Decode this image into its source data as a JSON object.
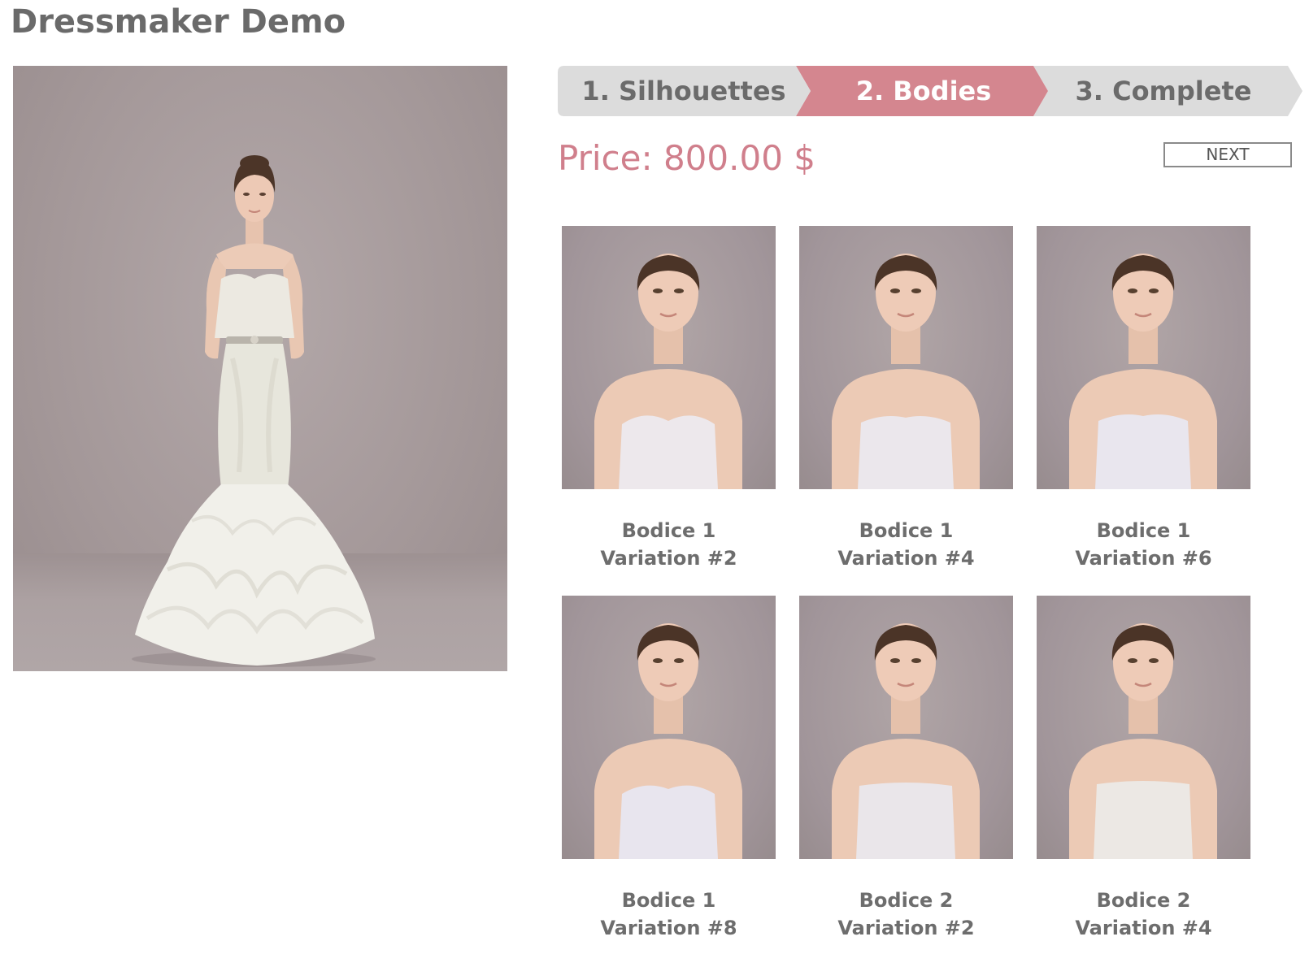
{
  "app": {
    "title": "Dressmaker Demo"
  },
  "preview": {
    "image_icon": "bride-full-gown-image"
  },
  "steps": [
    {
      "label": "1. Silhouettes",
      "active": false
    },
    {
      "label": "2. Bodies",
      "active": true
    },
    {
      "label": "3. Complete",
      "active": false
    }
  ],
  "colors": {
    "accent": "#d4868f",
    "step_inactive": "#dcdcdc",
    "price_text": "#d07f8c",
    "photo_background": "#a89c9d"
  },
  "price": {
    "text": "Price: 800.00 $"
  },
  "actions": {
    "next_label": "NEXT"
  },
  "bodices": [
    {
      "line1": "Bodice 1",
      "line2": "Variation #2",
      "icon": "bodice-sweetheart-image"
    },
    {
      "line1": "Bodice 1",
      "line2": "Variation #4",
      "icon": "bodice-sweetheart-image"
    },
    {
      "line1": "Bodice 1",
      "line2": "Variation #6",
      "icon": "bodice-sweetheart-image"
    },
    {
      "line1": "Bodice 1",
      "line2": "Variation #8",
      "icon": "bodice-sweetheart-image"
    },
    {
      "line1": "Bodice 2",
      "line2": "Variation #2",
      "icon": "bodice-straight-image"
    },
    {
      "line1": "Bodice 2",
      "line2": "Variation #4",
      "icon": "bodice-straight-image"
    }
  ]
}
